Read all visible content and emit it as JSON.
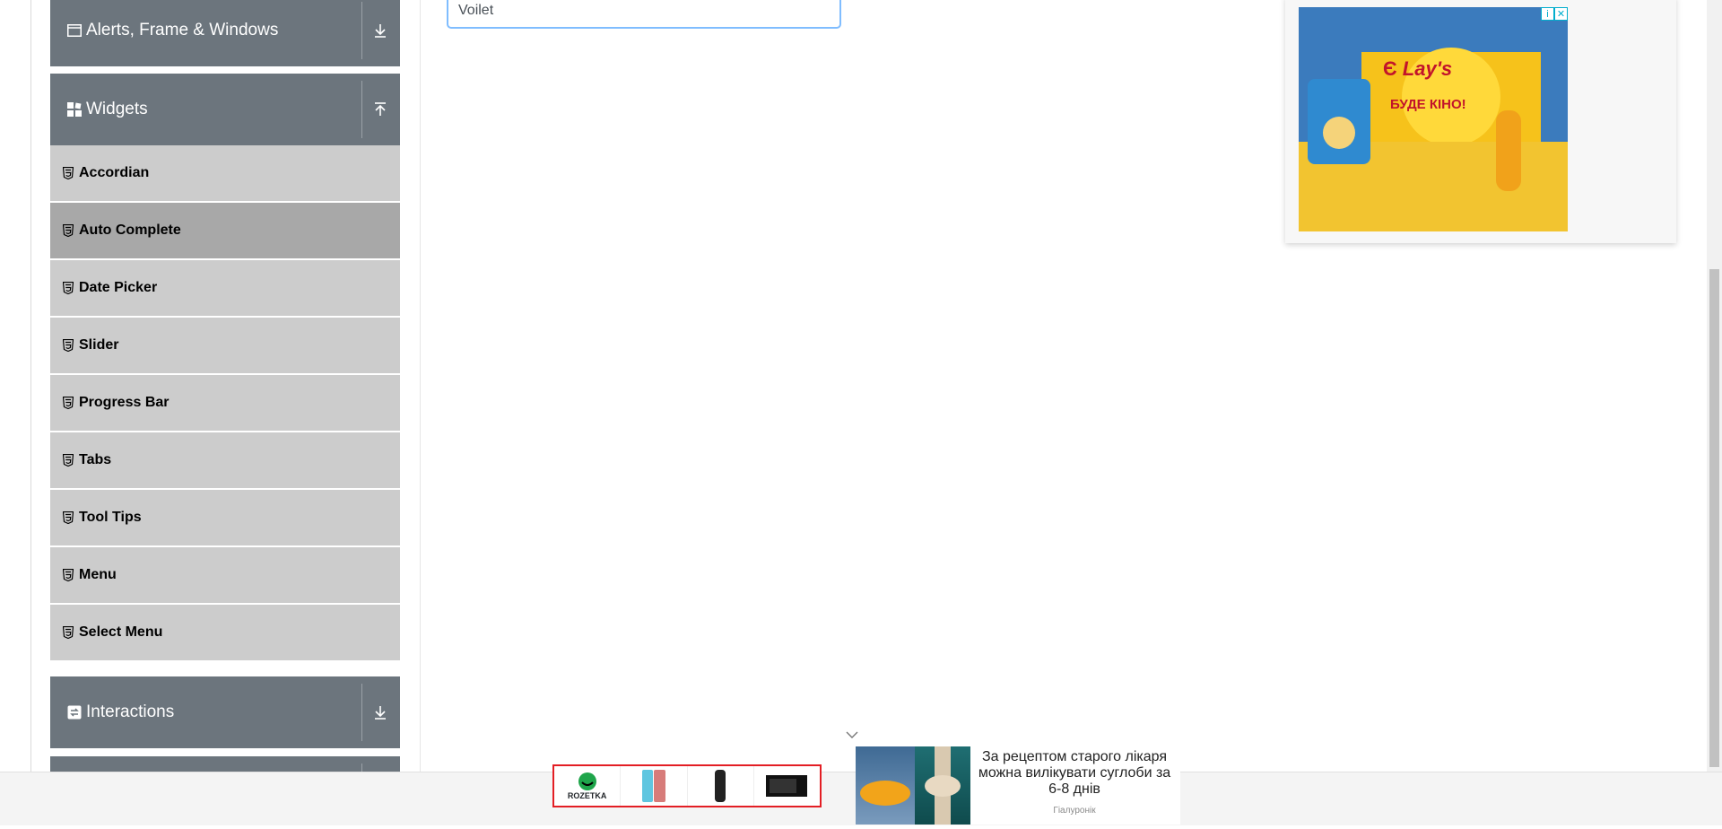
{
  "sidebar": {
    "groups": {
      "alerts": {
        "label": "Alerts, Frame & Windows"
      },
      "widgets": {
        "label": "Widgets"
      },
      "interactions": {
        "label": "Interactions"
      }
    },
    "widget_items": [
      {
        "label": "Accordian"
      },
      {
        "label": "Auto Complete"
      },
      {
        "label": "Date Picker"
      },
      {
        "label": "Slider"
      },
      {
        "label": "Progress Bar"
      },
      {
        "label": "Tabs"
      },
      {
        "label": "Tool Tips"
      },
      {
        "label": "Menu"
      },
      {
        "label": "Select Menu"
      }
    ],
    "active_item": "Auto Complete"
  },
  "main": {
    "input_value": "Voilet"
  },
  "ads": {
    "right_banner": {
      "brand": "Lay's",
      "headline_line1": "Є",
      "headline_line2": "БУДЕ КІНО!"
    },
    "bottom_left": {
      "brand": "ROZETKA"
    },
    "bottom_right": {
      "headline": "За рецептом старого лікаря можна вилікувати суглоби за 6-8 днів",
      "source": "Гіалуронік"
    }
  },
  "colors": {
    "group_header_bg": "#6c757d",
    "menu_item_bg": "#cccccc",
    "menu_item_active_bg": "#a8a8a8",
    "input_focus_border": "#80bdff"
  }
}
